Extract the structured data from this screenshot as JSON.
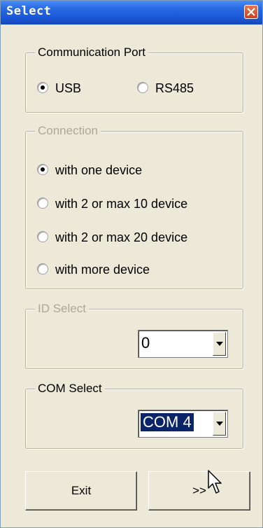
{
  "window": {
    "title": "Select",
    "close_icon": "close-icon"
  },
  "comm_port": {
    "legend": "Communication Port",
    "options": [
      {
        "label": "USB",
        "checked": true
      },
      {
        "label": "RS485",
        "checked": false
      }
    ]
  },
  "connection": {
    "legend": "Connection",
    "disabled": true,
    "options": [
      {
        "label": "with one device",
        "checked": true
      },
      {
        "label": "with 2 or max 10 device",
        "checked": false
      },
      {
        "label": "with 2 or max 20 device",
        "checked": false
      },
      {
        "label": "with more device",
        "checked": false
      }
    ]
  },
  "id_select": {
    "legend": "ID Select",
    "disabled": true,
    "value": "0"
  },
  "com_select": {
    "legend": "COM Select",
    "value": "COM 4"
  },
  "buttons": {
    "exit_label": "Exit",
    "next_label": ">>"
  },
  "colors": {
    "titlebar": "#1a58d8",
    "face": "#ece9d8",
    "selection": "#0a246a",
    "disabled_text": "#aca899"
  }
}
